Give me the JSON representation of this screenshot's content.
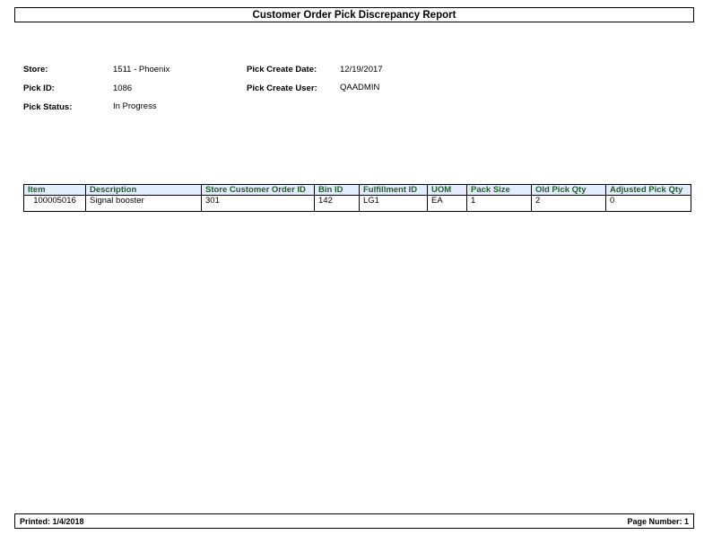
{
  "report": {
    "title": "Customer Order Pick Discrepancy Report"
  },
  "header_fields": {
    "store_label": "Store:",
    "store_value": "1511 - Phoenix",
    "pick_id_label": "Pick ID:",
    "pick_id_value": "1086",
    "pick_status_label": "Pick Status:",
    "pick_status_value": "In Progress",
    "pick_create_date_label": "Pick Create Date:",
    "pick_create_date_value": "12/19/2017",
    "pick_create_user_label": "Pick Create User:",
    "pick_create_user_value": "QAADMIN"
  },
  "table": {
    "columns": [
      "Item",
      "Description",
      "Store Customer Order ID",
      "Bin ID",
      "Fulfillment ID",
      "UOM",
      "Pack Size",
      "Old Pick Qty",
      "Adjusted Pick Qty"
    ],
    "rows": [
      [
        "100005016",
        "Signal booster",
        "301",
        "142",
        "LG1",
        "EA",
        "1",
        "2",
        "0"
      ]
    ]
  },
  "footer": {
    "printed": "Printed: 1/4/2018",
    "page_number": "Page Number: 1"
  },
  "colors": {
    "header_bg": "#e3ecfa",
    "header_text": "#1e5e2b"
  }
}
